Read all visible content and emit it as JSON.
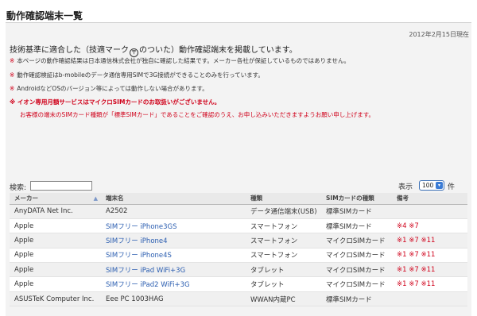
{
  "page": {
    "title": "動作確認端末一覧",
    "date": "2012年2月15日現在",
    "intro_before": "技術基準に適合した（技適マーク",
    "mark_symbol": "〒",
    "intro_after": "のついた）動作確認端末を掲載しています。"
  },
  "notes": [
    {
      "asterisk": "※",
      "text": "本ページの動作確認結果は日本通信株式会社が独自に確認した結果です。メーカー各社が保証しているものではありません。"
    },
    {
      "asterisk": "※",
      "text": "動作確認検証はb-mobileのデータ通信専用SIMで3G接続ができることのみを行っています。"
    },
    {
      "asterisk": "※",
      "text": "AndroidなどOSのバージョン等によっては動作しない場合があります。"
    }
  ],
  "warning": {
    "line1": "※ イオン専用月額サービスはマイクロSIMカードのお取扱いがございません。",
    "line2": "お客様の端末のSIMカード種類が「標準SIMカード」であることをご確認のうえ、お申し込みいただきますようお願い申し上げます。"
  },
  "controls": {
    "search_label": "検索:",
    "search_value": "",
    "show_label": "表示",
    "show_value": "100",
    "unit_label": "件"
  },
  "table": {
    "headers": [
      "メーカー",
      "端末名",
      "種類",
      "SIMカードの種類",
      "備考"
    ],
    "sort_indicator": "▲",
    "rows": [
      {
        "maker": "AnyDATA Net Inc.",
        "name": "A2502",
        "link": false,
        "type": "データ通信端末(USB)",
        "sim": "標準SIMカード",
        "remarks": ""
      },
      {
        "maker": "Apple",
        "name": "SIMフリー iPhone3GS",
        "link": true,
        "type": "スマートフォン",
        "sim": "標準SIMカード",
        "remarks": "※4 ※7"
      },
      {
        "maker": "Apple",
        "name": "SIMフリー iPhone4",
        "link": true,
        "type": "スマートフォン",
        "sim": "マイクロSIMカード",
        "remarks": "※1 ※7 ※11"
      },
      {
        "maker": "Apple",
        "name": "SIMフリー iPhone4S",
        "link": true,
        "type": "スマートフォン",
        "sim": "マイクロSIMカード",
        "remarks": "※1 ※7 ※11"
      },
      {
        "maker": "Apple",
        "name": "SIMフリー iPad WiFi+3G",
        "link": true,
        "type": "タブレット",
        "sim": "マイクロSIMカード",
        "remarks": "※1 ※7 ※11"
      },
      {
        "maker": "Apple",
        "name": "SIMフリー iPad2 WiFi+3G",
        "link": true,
        "type": "タブレット",
        "sim": "マイクロSIMカード",
        "remarks": "※1 ※7 ※11"
      },
      {
        "maker": "ASUSTeK Computer Inc.",
        "name": "Eee PC 1003HAG",
        "link": false,
        "type": "WWAN内蔵PC",
        "sim": "標準SIMカード",
        "remarks": ""
      }
    ]
  }
}
